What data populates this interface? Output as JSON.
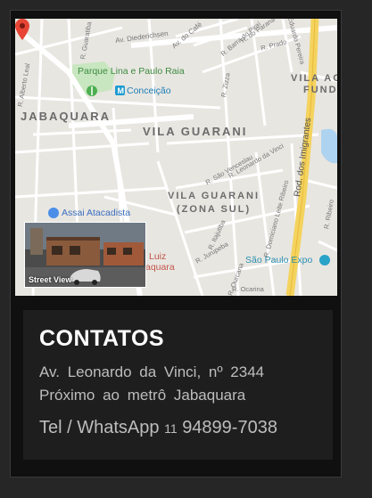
{
  "map": {
    "labels": {
      "area_jabaquara": "JABAQUARA",
      "area_vila_guarani": "VILA GUARANI",
      "area_vila_guarani_zs_1": "VILA GUARANI",
      "area_vila_guarani_zs_2": "(ZONA SUL)",
      "area_vila_fund_1": "VILA AG",
      "area_vila_fund_2": "FUND",
      "park": "Parque Lina e Paulo Raia",
      "metro": "Conceição",
      "assai": "Assai Atacadista",
      "expo": "São Paulo Expo",
      "luiz_1": "Luiz",
      "luiz_2": "aquara",
      "highway": "Rod. dos Imigrantes",
      "st_diederichsen": "Av. Diederichsen",
      "st_cafe": "Av. do Café",
      "st_leonardo": "R. Leonardo da Vinci",
      "st_sao_venceslau": "R. São Venceslau",
      "st_domiciano": "R. Domiciano Leite Ribeiro",
      "st_jurupeba": "R. Jurupeba",
      "st_itajutiba": "R. Itajutiba",
      "st_ourcana": "R. Ourcana",
      "st_ocarina": "R. Ocarina",
      "st_zizza": "R. Zizza",
      "st_prado": "R. Prado",
      "st_barra": "R. Barra do Piraí",
      "st_guaratiba": "R. Guaratiba",
      "st_alberto": "R. Alberto Leal",
      "st_pereira": "Eduardo Pereira",
      "st_ribeiro": "R. Ribeiro",
      "st_parana": "R. do Paraná"
    },
    "street_view_label": "Street View"
  },
  "contact": {
    "title": "CONTATOS",
    "address_line1": "Av. Leonardo da Vinci, nº 2344",
    "address_line2": "Próximo ao metrô Jabaquara",
    "phone_prefix": "Tel / WhatsApp",
    "phone_ddd": "11",
    "phone_number": "94899-7038"
  }
}
